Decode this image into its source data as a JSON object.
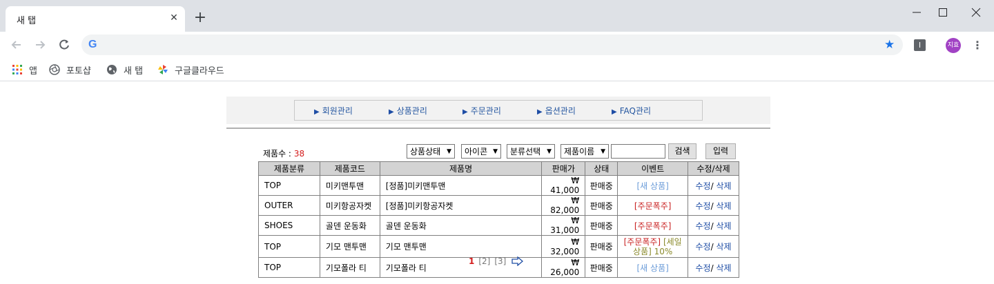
{
  "browser": {
    "tab_title": "새 탭",
    "bookmarks": [
      {
        "label": "앱",
        "icon": "apps-grid-icon"
      },
      {
        "label": "포토샵",
        "icon": "aperture-icon"
      },
      {
        "label": "새 탭",
        "icon": "globe-icon"
      },
      {
        "label": "구글클라우드",
        "icon": "pinwheel-icon"
      }
    ],
    "omnibox_logo": "G",
    "extension_label": "I",
    "profile_label": "지효",
    "colors": {
      "tabstrip": "#dee1e6",
      "accent": "#1a73e8",
      "avatar": "#a142c4"
    }
  },
  "admin_nav": {
    "items": [
      {
        "label": "회원관리"
      },
      {
        "label": "상품관리"
      },
      {
        "label": "주문관리"
      },
      {
        "label": "옵션관리"
      },
      {
        "label": "FAQ관리"
      }
    ]
  },
  "filters": {
    "count_label": "제품수 :",
    "count_value": "38",
    "status_select": "상품상태",
    "icon_select": "아이콘",
    "category_select": "분류선택",
    "field_select": "제품이름",
    "search_value": "",
    "search_button": "검색",
    "input_button": "입력"
  },
  "table": {
    "headers": [
      "제품분류",
      "제품코드",
      "제품명",
      "판매가",
      "상태",
      "이벤트",
      "수정/삭제"
    ],
    "rows": [
      {
        "category": "TOP",
        "code": "미키맨투맨",
        "name": "[정품]미키맨투맨",
        "price": "₩ 41,000",
        "status": "판매중",
        "event": "[새 상품]",
        "edit": "수정",
        "sep": "/",
        "delete": "삭제"
      },
      {
        "category": "OUTER",
        "code": "미키항공자켓",
        "name": "[정품]미키항공자켓",
        "price": "₩ 82,000",
        "status": "판매중",
        "event": "[주문폭주]",
        "edit": "수정",
        "sep": "/",
        "delete": "삭제"
      },
      {
        "category": "SHOES",
        "code": "골덴 운동화",
        "name": "골덴 운동화",
        "price": "₩ 31,000",
        "status": "판매중",
        "event": "[주문폭주]",
        "edit": "수정",
        "sep": "/",
        "delete": "삭제"
      },
      {
        "category": "TOP",
        "code": "기모 맨투맨",
        "name": "기모 맨투맨",
        "price": "₩ 32,000",
        "status": "판매중",
        "event": "[주문폭주]",
        "event2": "[세일상품] 10%",
        "edit": "수정",
        "sep": "/",
        "delete": "삭제"
      },
      {
        "category": "TOP",
        "code": "기모폴라 티",
        "name": "기모폴라 티",
        "price": "₩ 26,000",
        "status": "판매중",
        "event": "[새 상품]",
        "edit": "수정",
        "sep": "/",
        "delete": "삭제"
      }
    ]
  },
  "pagination": {
    "current": "1",
    "pages": [
      "[2]",
      "[3]"
    ]
  }
}
